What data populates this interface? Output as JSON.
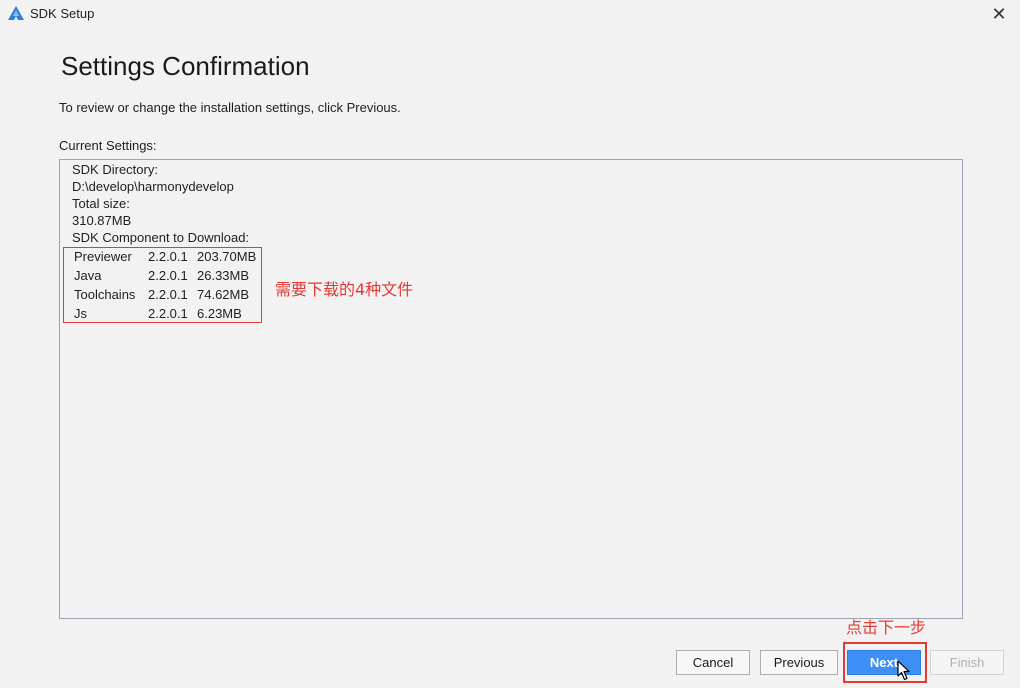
{
  "window": {
    "title": "SDK Setup",
    "close_glyph": "✕",
    "icon": "app-logo-icon"
  },
  "page": {
    "heading": "Settings Confirmation",
    "instruction": "To review or change the installation settings, click Previous.",
    "current_label": "Current Settings:"
  },
  "settings": {
    "sdk_directory_label": "SDK Directory:",
    "sdk_directory_value": "D:\\develop\\harmonydevelop",
    "total_size_label": "Total size:",
    "total_size_value": "310.87MB",
    "components_label": "SDK Component to Download:",
    "components": [
      {
        "name": "Previewer",
        "version": "2.2.0.1",
        "size": "203.70MB"
      },
      {
        "name": "Java",
        "version": "2.2.0.1",
        "size": "26.33MB"
      },
      {
        "name": "Toolchains",
        "version": "2.2.0.1",
        "size": "74.62MB"
      },
      {
        "name": "Js",
        "version": "2.2.0.1",
        "size": "6.23MB"
      }
    ]
  },
  "annotations": {
    "files_note": "需要下载的4种文件",
    "next_note": "点击下一步"
  },
  "buttons": {
    "cancel": "Cancel",
    "previous": "Previous",
    "next": "Next",
    "finish": "Finish"
  },
  "colors": {
    "accent": "#3d8ef5",
    "annotation": "#e53935"
  }
}
